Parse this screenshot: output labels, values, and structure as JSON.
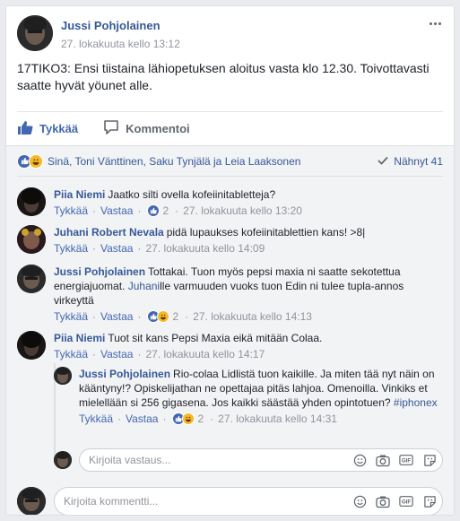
{
  "post": {
    "author": "Jussi Pohjolainen",
    "timestamp": "27. lokakuuta kello 13:12",
    "text": "17TIKO3: Ensi tiistaina lähiopetuksen aloitus vasta klo 12.30. Toivottavasti saatte hyvät yöunet alle."
  },
  "actions": {
    "like": "Tykkää",
    "comment": "Kommentoi"
  },
  "reactions": {
    "names": "Sinä, Toni Vänttinen, Saku Tynjälä ja Leia Laaksonen",
    "seen": "Nähnyt 41"
  },
  "comments": [
    {
      "author": "Piia Niemi",
      "text": "Jaatko silti ovella kofeiinitabletteja?",
      "like": "Tykkää",
      "reply": "Vastaa",
      "reaction_count": "2",
      "time": "27. lokakuuta kello 13:20"
    },
    {
      "author": "Juhani Robert Nevala",
      "text": "pidä lupaukses kofeiinitablettien kans! >8|",
      "like": "Tykkää",
      "reply": "Vastaa",
      "time": "27. lokakuuta kello 14:09"
    },
    {
      "author": "Jussi Pohjolainen",
      "text_before": "Tottakai. Tuon myös pepsi maxia ni saatte sekotettua energiajuomat.",
      "mention": "Juhani",
      "text_after": "lle varmuuden vuoks tuon Edin ni tulee tupla-annos virkeyttä",
      "like": "Tykkää",
      "reply": "Vastaa",
      "reaction_count": "2",
      "time": "27. lokakuuta kello 14:13"
    },
    {
      "author": "Piia Niemi",
      "text": "Tuot sit kans Pepsi Maxia eikä mitään Colaa.",
      "like": "Tykkää",
      "reply": "Vastaa",
      "time": "27. lokakuuta kello 14:17"
    }
  ],
  "reply": {
    "author": "Jussi Pohjolainen",
    "text": "Rio-colaa Lidlistä tuon kaikille. Ja miten tää nyt näin on kääntyny!? Opiskelijathan ne opettajaa pitäs lahjoa. Omenoilla. Vinkiks et mielellään si 256 gigasena. Jos kaikki säästää yhden opintotuen?",
    "hashtag": "#iphonex",
    "like": "Tykkää",
    "reply": "Vastaa",
    "reaction_count": "2",
    "time": "27. lokakuuta kello 14:31"
  },
  "reply_input": {
    "placeholder": "Kirjoita vastaus..."
  },
  "comment_input": {
    "placeholder": "Kirjoita kommentti..."
  },
  "colors": {
    "link": "#365899",
    "like_blue": "#4267b2",
    "haha_yellow": "#f7b928"
  }
}
